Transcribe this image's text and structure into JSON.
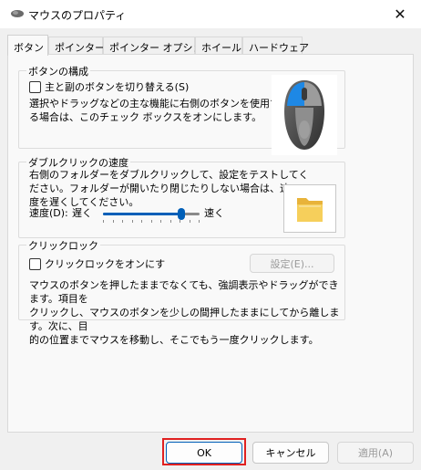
{
  "window": {
    "title": "マウスのプロパティ",
    "close_glyph": "✕"
  },
  "tabs": [
    {
      "label": "ボタン",
      "active": true
    },
    {
      "label": "ポインター",
      "active": false
    },
    {
      "label": "ポインター オプション",
      "active": false
    },
    {
      "label": "ホイール",
      "active": false
    },
    {
      "label": "ハードウェア",
      "active": false
    }
  ],
  "button_config": {
    "legend": "ボタンの構成",
    "checkbox_label": "主と副のボタンを切り替える(S)",
    "checked": false,
    "desc_lines": [
      "選択やドラッグなどの主な機能に右側のボタンを使用す",
      "る場合は、このチェック ボックスをオンにします。"
    ]
  },
  "double_click": {
    "legend": "ダブルクリックの速度",
    "desc_lines": [
      "右側のフォルダーをダブルクリックして、設定をテストしてく",
      "ださい。フォルダーが開いたり閉じたりしない場合は、速",
      "度を遅くしてください。"
    ],
    "speed_label": "速度(D):",
    "slow_label": "遅く",
    "fast_label": "速く",
    "speed_fraction": 0.81
  },
  "click_lock": {
    "legend": "クリックロック",
    "checkbox_label": "クリックロックをオンにす",
    "checked": false,
    "settings_button": "設定(E)...",
    "desc_lines": [
      "マウスのボタンを押したままでなくても、強調表示やドラッグができます。項目を",
      "クリックし、マウスのボタンを少しの間押したままにしてから離します。次に、目",
      "的の位置までマウスを移動し、そこでもう一度クリックします。"
    ]
  },
  "footer": {
    "ok": "OK",
    "cancel": "キャンセル",
    "apply": "適用(A)"
  },
  "colors": {
    "accent": "#005fb8",
    "highlight_ring": "#e02020",
    "mouse_button_highlight": "#1e88e5"
  }
}
